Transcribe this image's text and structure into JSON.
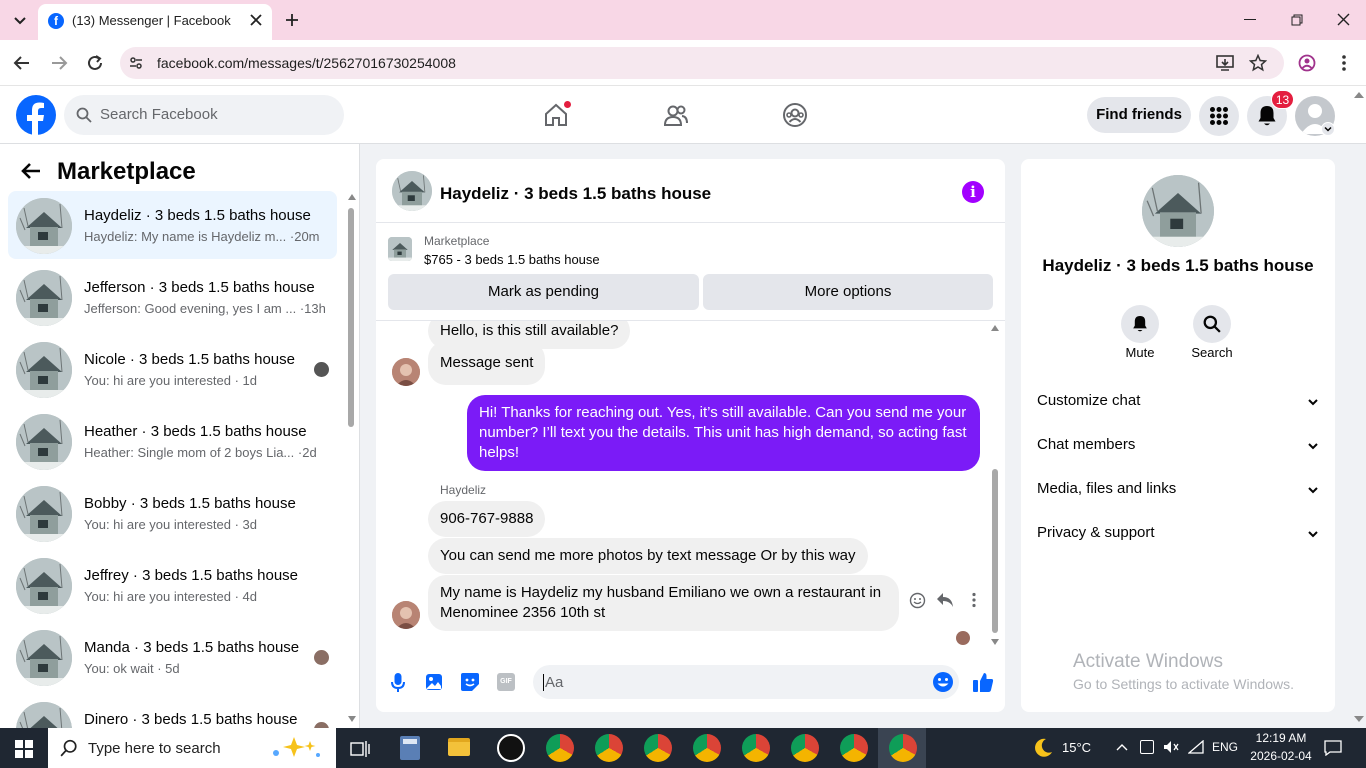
{
  "browser": {
    "tab_title": "(13) Messenger | Facebook",
    "url": "facebook.com/messages/t/25627016730254008"
  },
  "fb_nav": {
    "search_placeholder": "Search Facebook",
    "find_friends": "Find friends",
    "notif_count": "13"
  },
  "left": {
    "header": "Marketplace",
    "conversations": [
      {
        "title": "Haydeliz · 3 beds 1.5 baths house",
        "snippet": "Haydeliz: My name is Haydeliz m... ·20m"
      },
      {
        "title": "Jefferson · 3 beds 1.5 baths house",
        "snippet": "Jefferson: Good evening, yes I am ... ·13h"
      },
      {
        "title": "Nicole · 3 beds 1.5 baths house",
        "snippet": "You: hi are you interested · 1d"
      },
      {
        "title": "Heather · 3 beds 1.5 baths house",
        "snippet": "Heather: Single mom of 2 boys Lia... ·2d"
      },
      {
        "title": "Bobby · 3 beds 1.5 baths house",
        "snippet": "You: hi are you interested · 3d"
      },
      {
        "title": "Jeffrey · 3 beds 1.5 baths house",
        "snippet": "You: hi are you interested · 4d"
      },
      {
        "title": "Manda · 3 beds 1.5 baths house",
        "snippet": "You: ok wait · 5d"
      },
      {
        "title": "Dinero · 3 beds 1.5 baths house",
        "snippet": ""
      }
    ]
  },
  "chat": {
    "title": "Haydeliz · 3 beds 1.5 baths house",
    "listing_label": "Marketplace",
    "listing_desc": "$765 - 3 beds 1.5 baths house",
    "mark_pending": "Mark as pending",
    "more_options": "More options",
    "messages": {
      "m0": "Hello, is this still available?",
      "m1": "Message sent",
      "m2": "Hi! Thanks for reaching out. Yes, it’s still available. Can you send me your number? I’ll text you the details. This unit has high demand, so acting fast helps!",
      "sender": "Haydeliz",
      "m3": "906-767-9888",
      "m4": "You can send me more photos by text message Or by this way",
      "m5": "My name is Haydeliz my husband Emiliano we own a restaurant in Menominee 2356 10th st"
    },
    "composer_placeholder": "Aa",
    "gif_label": "GIF"
  },
  "right": {
    "title": "Haydeliz · 3 beds 1.5 baths house",
    "mute": "Mute",
    "search": "Search",
    "sections": [
      "Customize chat",
      "Chat members",
      "Media, files and links",
      "Privacy & support"
    ],
    "watermark_title": "Activate Windows",
    "watermark_sub": "Go to Settings to activate Windows."
  },
  "taskbar": {
    "search_placeholder": "Type here to search",
    "temperature": "15°C",
    "language": "ENG",
    "time": "12:19 AM",
    "date": "2026-02-04"
  },
  "colors": {
    "fb_blue": "#0866ff",
    "messenger_purple": "#7b1bf7",
    "notif_red": "#e41e3f"
  }
}
